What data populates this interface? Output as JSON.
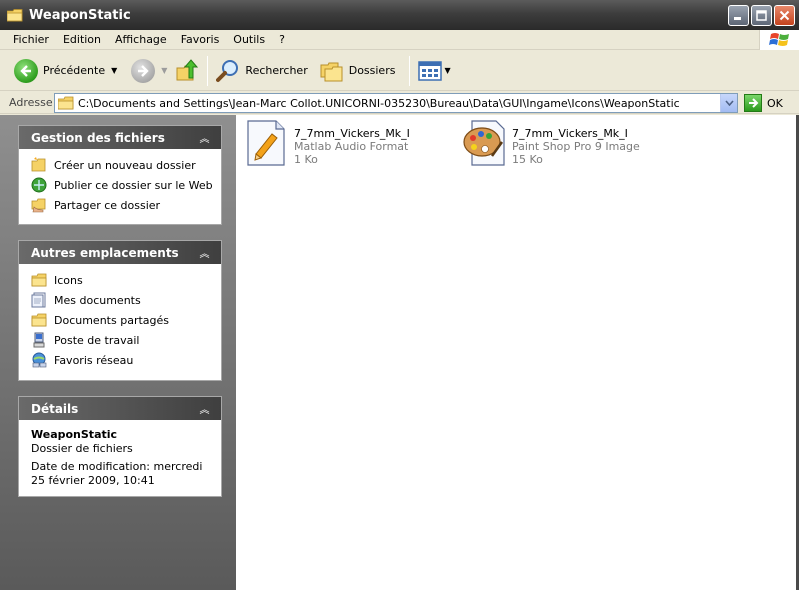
{
  "window": {
    "title": "WeaponStatic"
  },
  "menu": {
    "items": [
      "Fichier",
      "Edition",
      "Affichage",
      "Favoris",
      "Outils",
      "?"
    ]
  },
  "toolbar": {
    "back_label": "Précédente",
    "search_label": "Rechercher",
    "folders_label": "Dossiers"
  },
  "address": {
    "label": "Adresse",
    "path": "C:\\Documents and Settings\\Jean-Marc Collot.UNICORNI-035230\\Bureau\\Data\\GUI\\Ingame\\Icons\\WeaponStatic",
    "go_label": "OK"
  },
  "panels": {
    "file_tasks": {
      "title": "Gestion des fichiers",
      "items": [
        {
          "label": "Créer un nouveau dossier",
          "icon": "new-folder-icon"
        },
        {
          "label": "Publier ce dossier sur le Web",
          "icon": "web-publish-icon"
        },
        {
          "label": "Partager ce dossier",
          "icon": "share-folder-icon"
        }
      ]
    },
    "other_places": {
      "title": "Autres emplacements",
      "items": [
        {
          "label": "Icons",
          "icon": "folder-icon"
        },
        {
          "label": "Mes documents",
          "icon": "my-documents-icon"
        },
        {
          "label": "Documents partagés",
          "icon": "shared-documents-icon"
        },
        {
          "label": "Poste de travail",
          "icon": "my-computer-icon"
        },
        {
          "label": "Favoris réseau",
          "icon": "network-places-icon"
        }
      ]
    },
    "details": {
      "title": "Détails",
      "name": "WeaponStatic",
      "type": "Dossier de fichiers",
      "modified": "Date de modification: mercredi 25 février 2009, 10:41"
    }
  },
  "files": [
    {
      "name": "7_7mm_Vickers_Mk_I",
      "type": "Matlab Audio Format",
      "size": "1 Ko",
      "icon": "matlab-audio-file-icon"
    },
    {
      "name": "7_7mm_Vickers_Mk_I",
      "type": "Paint Shop Pro 9 Image",
      "size": "15 Ko",
      "icon": "psp-image-file-icon"
    }
  ],
  "colors": {
    "title_bar": "#3d3d3d",
    "task_pane": "#7a7a7a",
    "panel_header": "#4f4f4f",
    "go_green": "#2b9a1c"
  }
}
